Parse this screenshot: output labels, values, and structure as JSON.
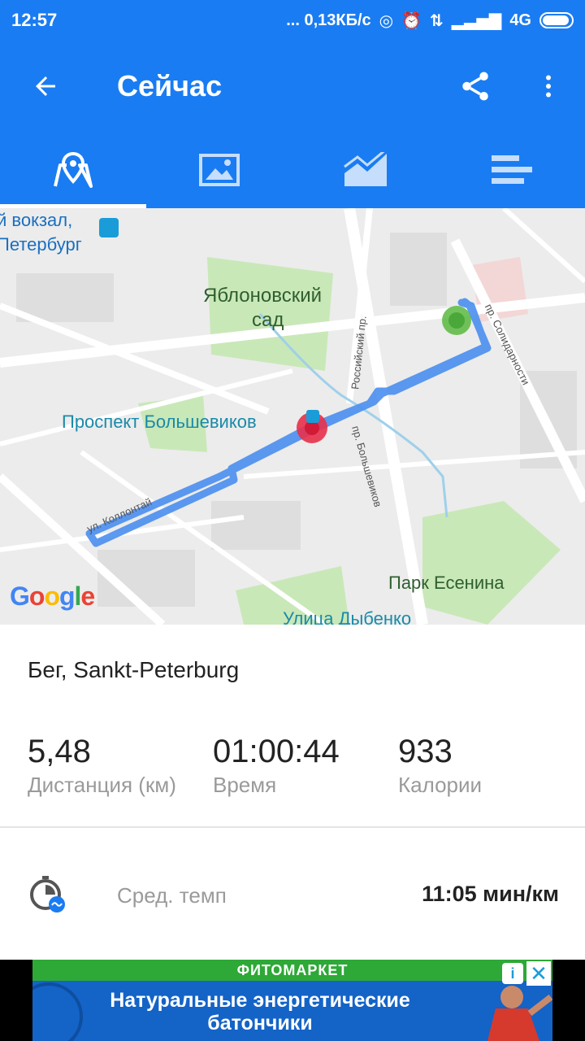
{
  "status_bar": {
    "time": "12:57",
    "speed": "... 0,13КБ/с",
    "network": "4G"
  },
  "app_bar": {
    "title": "Сейчас",
    "back_icon": "arrow-left-icon",
    "share_icon": "share-icon",
    "more_icon": "more-vertical-icon"
  },
  "tabs": [
    {
      "icon": "map-icon",
      "active": true
    },
    {
      "icon": "image-icon",
      "active": false
    },
    {
      "icon": "chart-area-icon",
      "active": false
    },
    {
      "icon": "bars-icon",
      "active": false
    }
  ],
  "map": {
    "labels": {
      "station": "й вокзал,",
      "station2": "Петербург",
      "garden1": "Яблоновский",
      "garden2": "сад",
      "metro": "Проспект Большевиков",
      "park": "Парк Есенина",
      "street_bottom": "Улица Дыбенко",
      "rossiysky": "Российский пр.",
      "bolshevikov": "пр. Большевиков",
      "solidarnosti": "пр. Солидарности",
      "kollontai": "ул. Коллонтай"
    },
    "logo": "Google"
  },
  "activity": {
    "title": "Бег, Sankt-Peterburg",
    "stats": [
      {
        "value": "5,48",
        "label": "Дистанция (км)"
      },
      {
        "value": "01:00:44",
        "label": "Время"
      },
      {
        "value": "933",
        "label": "Калории"
      }
    ],
    "pace_label": "Сред. темп",
    "pace_value": "11:05 мин/км"
  },
  "ad": {
    "brand": "ФИТОМАРКЕТ",
    "text": "Натуральные энергетические батончики",
    "info": "i",
    "close": "✕"
  },
  "colors": {
    "primary": "#1a7cf2",
    "route": "#4a8ef0",
    "start": "#5ab940",
    "end": "#e8304a"
  }
}
